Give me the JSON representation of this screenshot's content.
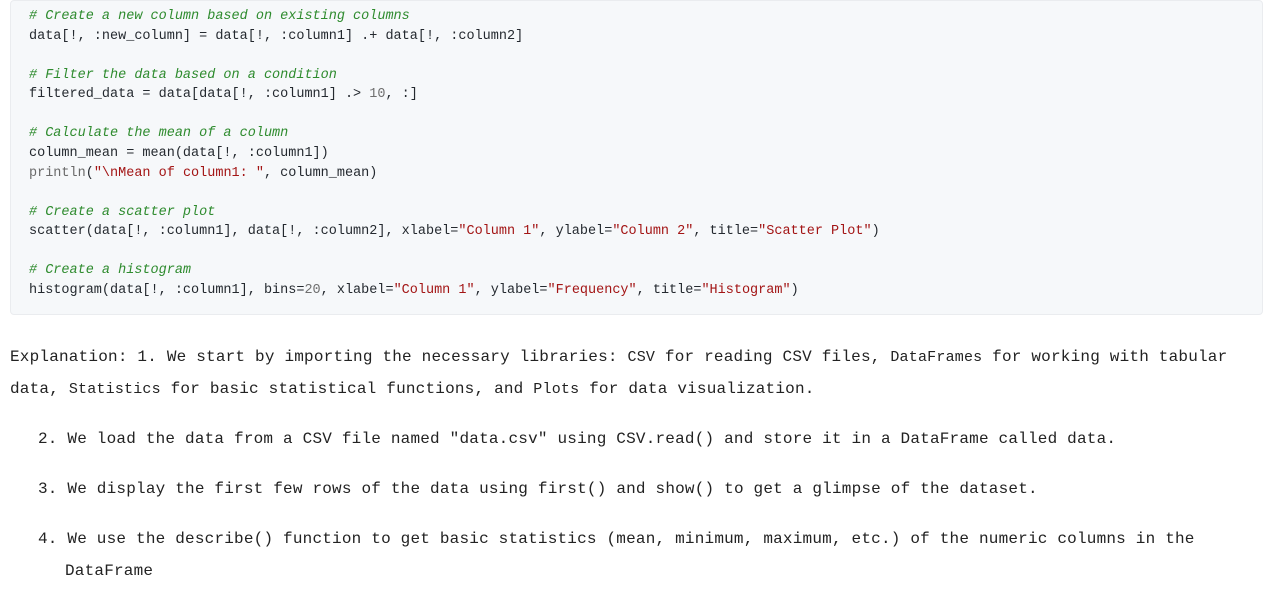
{
  "code": {
    "c1": "# Create a new column based on existing columns",
    "l1": "data[!, :new_column] = data[!, :column1] .+ data[!, :column2]",
    "c2": "# Filter the data based on a condition",
    "l2a": "filtered_data = data[data[!, :column1] .> ",
    "l2num": "10",
    "l2b": ", :]",
    "c3": "# Calculate the mean of a column",
    "l3": "column_mean = mean(data[!, :column1])",
    "l4fn": "println",
    "l4a": "(",
    "l4s": "\"\\nMean of column1: \"",
    "l4b": ", column_mean)",
    "c5": "# Create a scatter plot",
    "l5a": "scatter(data[!, :column1], data[!, :column2], xlabel=",
    "l5s1": "\"Column 1\"",
    "l5b": ", ylabel=",
    "l5s2": "\"Column 2\"",
    "l5c": ", title=",
    "l5s3": "\"Scatter Plot\"",
    "l5d": ")",
    "c6": "# Create a histogram",
    "l6a": "histogram(data[!, :column1], bins=",
    "l6num": "20",
    "l6b": ", xlabel=",
    "l6s1": "\"Column 1\"",
    "l6c": ", ylabel=",
    "l6s2": "\"Frequency\"",
    "l6d": ", title=",
    "l6s3": "\"Histogram\"",
    "l6e": ")"
  },
  "explain": {
    "p1_a": "Explanation: 1. We start by importing the necessary libraries: ",
    "p1_c1": "CSV",
    "p1_b": " for reading CSV files, ",
    "p1_c2": "DataFrames",
    "p1_c": " for working with tabular data, ",
    "p1_c3": "Statistics",
    "p1_d": " for basic statistical functions, and ",
    "p1_c4": "Plots",
    "p1_e": " for data visualization.",
    "li2_a": "2. We load the data from a CSV file named \"data.csv\" using ",
    "li2_c1": "CSV.read()",
    "li2_b": " and store it in a DataFrame called ",
    "li2_c2": "data",
    "li2_c": ".",
    "li3_a": "3. We display the first few rows of the data using ",
    "li3_c1": "first()",
    "li3_b": " and ",
    "li3_c2": "show()",
    "li3_c": " to get a glimpse of the dataset.",
    "li4_a": "4. We use the ",
    "li4_c1": "describe()",
    "li4_b": " function to get basic statistics (mean, minimum, maximum, etc.) of the numeric columns in the DataFrame"
  }
}
